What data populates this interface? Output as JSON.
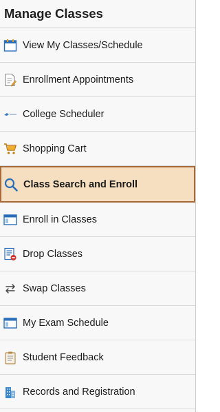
{
  "header": {
    "title": "Manage Classes"
  },
  "menu": {
    "items": [
      {
        "label": "View My Classes/Schedule",
        "icon": "calendar-icon"
      },
      {
        "label": "Enrollment Appointments",
        "icon": "document-edit-icon"
      },
      {
        "label": "College Scheduler",
        "icon": "college-scheduler-logo-icon"
      },
      {
        "label": "Shopping Cart",
        "icon": "shopping-cart-icon"
      },
      {
        "label": "Class Search and Enroll",
        "icon": "search-icon",
        "active": true
      },
      {
        "label": "Enroll in Classes",
        "icon": "window-icon"
      },
      {
        "label": "Drop Classes",
        "icon": "drop-list-icon"
      },
      {
        "label": "Swap Classes",
        "icon": "swap-arrows-icon"
      },
      {
        "label": "My Exam Schedule",
        "icon": "window-icon"
      },
      {
        "label": "Student Feedback",
        "icon": "clipboard-icon"
      },
      {
        "label": "Records and Registration",
        "icon": "building-icon"
      }
    ]
  },
  "colors": {
    "active_bg": "#f6dfc0",
    "active_border": "#a66a3a",
    "icon_blue": "#2a6ebb"
  }
}
